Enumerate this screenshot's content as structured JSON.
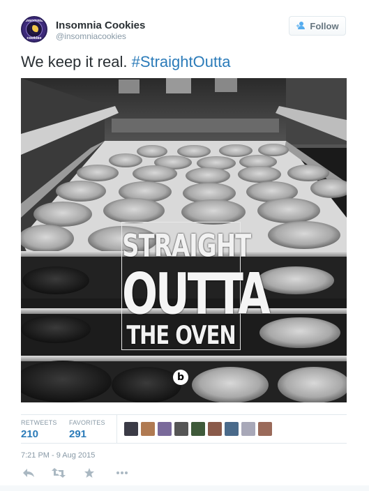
{
  "user": {
    "name": "Insomnia Cookies",
    "handle": "@insomniacookies",
    "avatar_icon": "insomnia-cookies-logo",
    "avatar_text_top": "insomnia",
    "avatar_text_bottom": "cookies"
  },
  "follow_button": {
    "label": "Follow",
    "icon": "add-user-icon"
  },
  "tweet": {
    "text": "We keep it real.",
    "hashtag": "#StraightOutta"
  },
  "media": {
    "overlay_line1": "STRAIGHT",
    "overlay_line2": "OUTTA",
    "overlay_line3": "THE OVEN",
    "logo_letter": "b"
  },
  "stats": {
    "retweets_label": "RETWEETS",
    "retweets_count": "210",
    "favorites_label": "FAVORITES",
    "favorites_count": "291"
  },
  "favoriters": [
    {
      "name": "favoriter-avatar-1",
      "color": "#3b3b46"
    },
    {
      "name": "favoriter-avatar-2",
      "color": "#b07a52"
    },
    {
      "name": "favoriter-avatar-3",
      "color": "#7a6a9b"
    },
    {
      "name": "favoriter-avatar-4",
      "color": "#555555"
    },
    {
      "name": "favoriter-avatar-5",
      "color": "#3f5a3a"
    },
    {
      "name": "favoriter-avatar-6",
      "color": "#8a5a4a"
    },
    {
      "name": "favoriter-avatar-7",
      "color": "#4a6a8a"
    },
    {
      "name": "favoriter-avatar-8",
      "color": "#a8a8b8"
    },
    {
      "name": "favoriter-avatar-9",
      "color": "#9a6a5a"
    }
  ],
  "timestamp": "7:21 PM - 9 Aug 2015",
  "actions": [
    "reply-icon",
    "retweet-icon",
    "favorite-star-icon",
    "more-options-icon"
  ],
  "colors": {
    "link": "#2b7bb9",
    "muted": "#8899a6",
    "border": "#e1e8ed",
    "follow_icon": "#55acee"
  }
}
